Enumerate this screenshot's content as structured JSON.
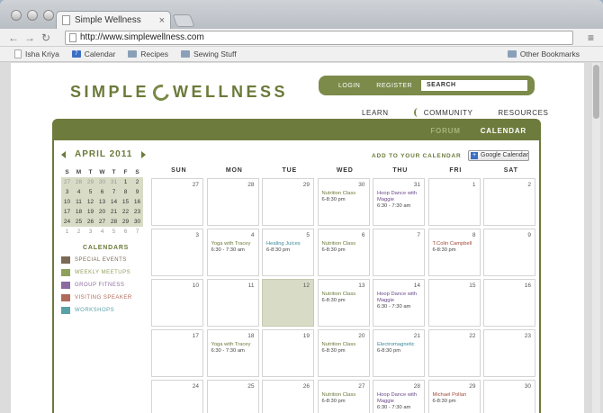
{
  "browser": {
    "tab_title": "Simple Wellness",
    "url": "http://www.simplewellness.com",
    "bookmarks": [
      "Isha Kriya",
      "Calendar",
      "Recipes",
      "Sewing Stuff"
    ],
    "other_bookmarks": "Other Bookmarks"
  },
  "site": {
    "logo_left": "SIMPLE",
    "logo_right": "WELLNESS",
    "login": "LOGIN",
    "register": "REGISTER",
    "search": "SEARCH",
    "nav": [
      "LEARN",
      "COMMUNITY",
      "RESOURCES"
    ],
    "panel_tabs": {
      "forum": "FORUM",
      "calendar": "CALENDAR"
    },
    "add_to_calendar": "ADD TO YOUR CALENDAR",
    "google_calendar": "Google Calendar"
  },
  "mini_calendar": {
    "month": "APRIL 2011",
    "days_header": [
      "S",
      "M",
      "T",
      "W",
      "T",
      "F",
      "S"
    ],
    "weeks": [
      [
        "27",
        "28",
        "29",
        "30",
        "31",
        "1",
        "2"
      ],
      [
        "3",
        "4",
        "5",
        "6",
        "7",
        "8",
        "9"
      ],
      [
        "10",
        "11",
        "12",
        "13",
        "14",
        "15",
        "16"
      ],
      [
        "17",
        "18",
        "19",
        "20",
        "21",
        "22",
        "23"
      ],
      [
        "24",
        "25",
        "26",
        "27",
        "28",
        "29",
        "30"
      ],
      [
        "1",
        "2",
        "3",
        "4",
        "5",
        "6",
        "7"
      ]
    ]
  },
  "calendars": {
    "title": "CALENDARS",
    "items": [
      {
        "label": "SPECIAL EVENTS",
        "color": "#7a6a55"
      },
      {
        "label": "WEEKLY MEETUPS",
        "color": "#8fa05a"
      },
      {
        "label": "GROUP FITNESS",
        "color": "#8a6aa0"
      },
      {
        "label": "VISITING SPEAKER",
        "color": "#b06a5a"
      },
      {
        "label": "WORKSHOPS",
        "color": "#5aa0a8"
      }
    ]
  },
  "calendar": {
    "days_of_week": [
      "SUN",
      "MON",
      "TUE",
      "WED",
      "THU",
      "FRI",
      "SAT"
    ],
    "weeks": [
      [
        {
          "n": "27"
        },
        {
          "n": "28"
        },
        {
          "n": "29"
        },
        {
          "n": "30",
          "e": "Nutrition Class",
          "t": "6-8:30 pm",
          "c": "#6b7a3a"
        },
        {
          "n": "31",
          "e": "Hoop Dance with Maggie",
          "t": "6:30 - 7:30 am",
          "c": "#6a4a8a"
        },
        {
          "n": "1"
        },
        {
          "n": "2"
        }
      ],
      [
        {
          "n": "3"
        },
        {
          "n": "4",
          "e": "Yoga with Tracey",
          "t": "6:30 - 7:30 am",
          "c": "#6b7a3a"
        },
        {
          "n": "5",
          "e": "Healing Juices",
          "t": "6-8:30 pm",
          "c": "#3a8a98"
        },
        {
          "n": "6",
          "e": "Nutrition Class",
          "t": "6-8:30 pm",
          "c": "#6b7a3a"
        },
        {
          "n": "7"
        },
        {
          "n": "8",
          "e": "T.Colin Campbell",
          "t": "6-8:30 pm",
          "c": "#a04a3a"
        },
        {
          "n": "9"
        }
      ],
      [
        {
          "n": "10"
        },
        {
          "n": "11"
        },
        {
          "n": "12",
          "today": true
        },
        {
          "n": "13",
          "e": "Nutrition Class",
          "t": "6-8:30 pm",
          "c": "#6b7a3a"
        },
        {
          "n": "14",
          "e": "Hoop Dance with Maggie",
          "t": "6:30 - 7:30 am",
          "c": "#6a4a8a"
        },
        {
          "n": "15"
        },
        {
          "n": "16"
        }
      ],
      [
        {
          "n": "17"
        },
        {
          "n": "18",
          "e": "Yoga with Tracey",
          "t": "6:30 - 7:30 am",
          "c": "#6b7a3a"
        },
        {
          "n": "19"
        },
        {
          "n": "20",
          "e": "Nutrition Class",
          "t": "6-8:30 pm",
          "c": "#6b7a3a"
        },
        {
          "n": "21",
          "e": "Electromagnetic",
          "t": "6-8:30 pm",
          "c": "#3a8a98"
        },
        {
          "n": "22"
        },
        {
          "n": "23"
        }
      ],
      [
        {
          "n": "24"
        },
        {
          "n": "25"
        },
        {
          "n": "26"
        },
        {
          "n": "27",
          "e": "Nutrition Class",
          "t": "6-8:30 pm",
          "c": "#6b7a3a"
        },
        {
          "n": "28",
          "e": "Hoop Dance with Maggie",
          "t": "6:30 - 7:30 am",
          "c": "#6a4a8a"
        },
        {
          "n": "29",
          "e": "Michael Pollan",
          "t": "6-8:30 pm",
          "c": "#a04a3a"
        },
        {
          "n": "30"
        }
      ]
    ]
  }
}
